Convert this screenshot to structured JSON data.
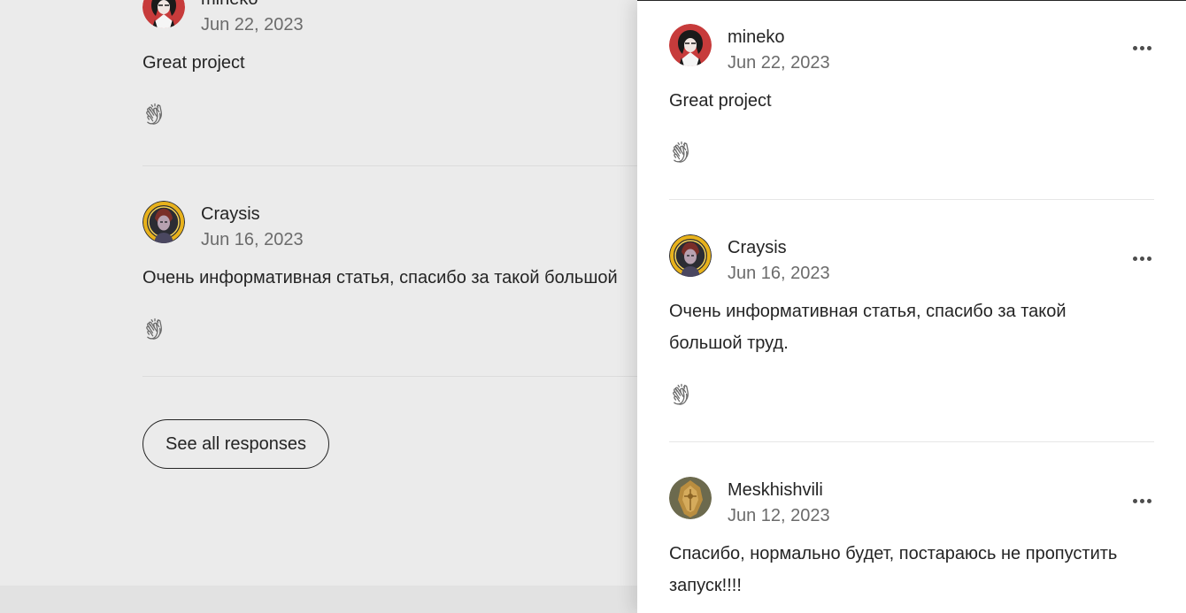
{
  "colors": {
    "text": "#242424",
    "muted": "#6b6b6b",
    "panel_bg": "#ffffff",
    "page_bg": "#ebebeb"
  },
  "background": {
    "responses": [
      {
        "author": "mineko",
        "date": "Jun 22, 2023",
        "text": "Great project",
        "avatar_icon": "red-portrait-avatar"
      },
      {
        "author": "Craysis",
        "date": "Jun 16, 2023",
        "text": "Очень информативная статья, спасибо за такой большой",
        "avatar_icon": "fiery-portrait-avatar"
      }
    ],
    "see_all_label": "See all responses"
  },
  "panel": {
    "responses": [
      {
        "author": "mineko",
        "date": "Jun 22, 2023",
        "text": "Great project",
        "avatar_icon": "red-portrait-avatar"
      },
      {
        "author": "Craysis",
        "date": "Jun 16, 2023",
        "text": "Очень информативная статья, спасибо за такой большой труд.",
        "avatar_icon": "fiery-portrait-avatar"
      },
      {
        "author": "Meskhishvili",
        "date": "Jun 12, 2023",
        "text": "Спасибо, нормально будет, постараюсь не пропустить запуск!!!!",
        "avatar_icon": "golden-crest-avatar"
      }
    ]
  }
}
